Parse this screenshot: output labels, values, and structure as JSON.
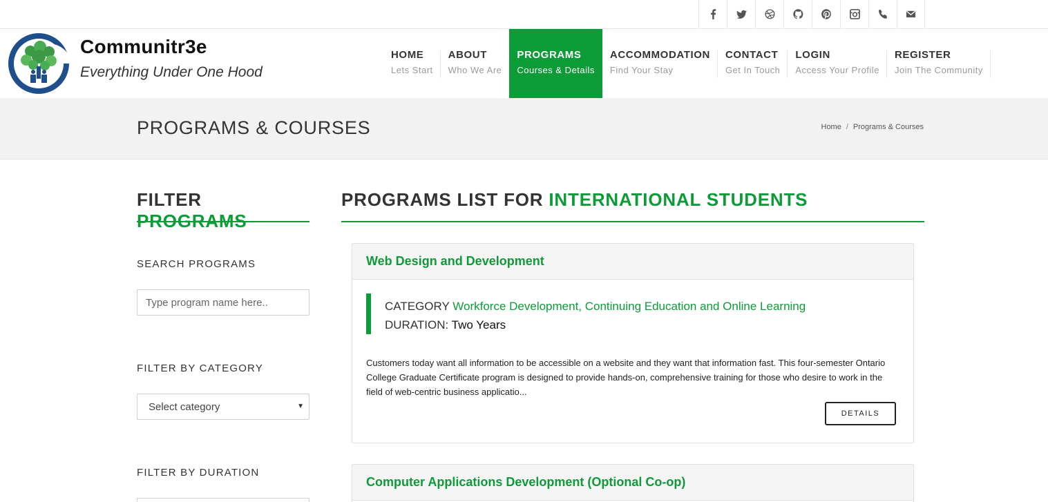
{
  "social": [
    {
      "icon": "facebook-icon",
      "glyph": "f"
    },
    {
      "icon": "twitter-icon",
      "glyph": "t"
    },
    {
      "icon": "dribbble-icon",
      "glyph": "d"
    },
    {
      "icon": "github-icon",
      "glyph": "g"
    },
    {
      "icon": "pinterest-icon",
      "glyph": "p"
    },
    {
      "icon": "instagram-icon",
      "glyph": "i"
    },
    {
      "icon": "phone-icon",
      "glyph": "ph"
    },
    {
      "icon": "email-icon",
      "glyph": "e"
    }
  ],
  "brand": {
    "name": "Communitr3e",
    "tagline": "Everything Under One Hood"
  },
  "nav": [
    {
      "title": "HOME",
      "sub": "Lets Start",
      "active": false
    },
    {
      "title": "ABOUT",
      "sub": "Who We Are",
      "active": false
    },
    {
      "title": "PROGRAMS",
      "sub": "Courses & Details",
      "active": true
    },
    {
      "title": "ACCOMMODATION",
      "sub": "Find Your Stay",
      "active": false
    },
    {
      "title": "CONTACT",
      "sub": "Get In Touch",
      "active": false
    },
    {
      "title": "LOGIN",
      "sub": "Access Your Profile",
      "active": false
    },
    {
      "title": "REGISTER",
      "sub": "Join The Community",
      "active": false
    }
  ],
  "page": {
    "title": "PROGRAMS & COURSES",
    "breadcrumb": [
      "Home",
      "Programs & Courses"
    ],
    "breadcrumb_sep": "/"
  },
  "sidebar": {
    "heading_plain": "FILTER ",
    "heading_accent": "PROGRAMS",
    "search_label": "SEARCH PROGRAMS",
    "search_placeholder": "Type program name here..",
    "category_label": "FILTER BY CATEGORY",
    "category_value": "Select category",
    "duration_label": "FILTER BY DURATION"
  },
  "main": {
    "heading_plain": "PROGRAMS LIST FOR ",
    "heading_accent": "INTERNATIONAL STUDENTS",
    "programs": [
      {
        "title": "Web Design and Development",
        "category_label": "CATEGORY",
        "category": "Workforce Development, Continuing Education and Online Learning",
        "duration_label": "DURATION:",
        "duration": "Two Years",
        "description": "Customers today want all information to be accessible on a website and they want that information fast. This four-semester Ontario College Graduate Certificate program is designed to provide hands-on, comprehensive training for those who desire to work in the field of web-centric business applicatio...",
        "button": "DETAILS"
      },
      {
        "title": "Computer Applications Development (Optional Co-op)"
      }
    ]
  },
  "colors": {
    "accent": "#0d9b38",
    "logo_blue": "#1f4e8c",
    "band_grey": "#f2f2f2"
  }
}
